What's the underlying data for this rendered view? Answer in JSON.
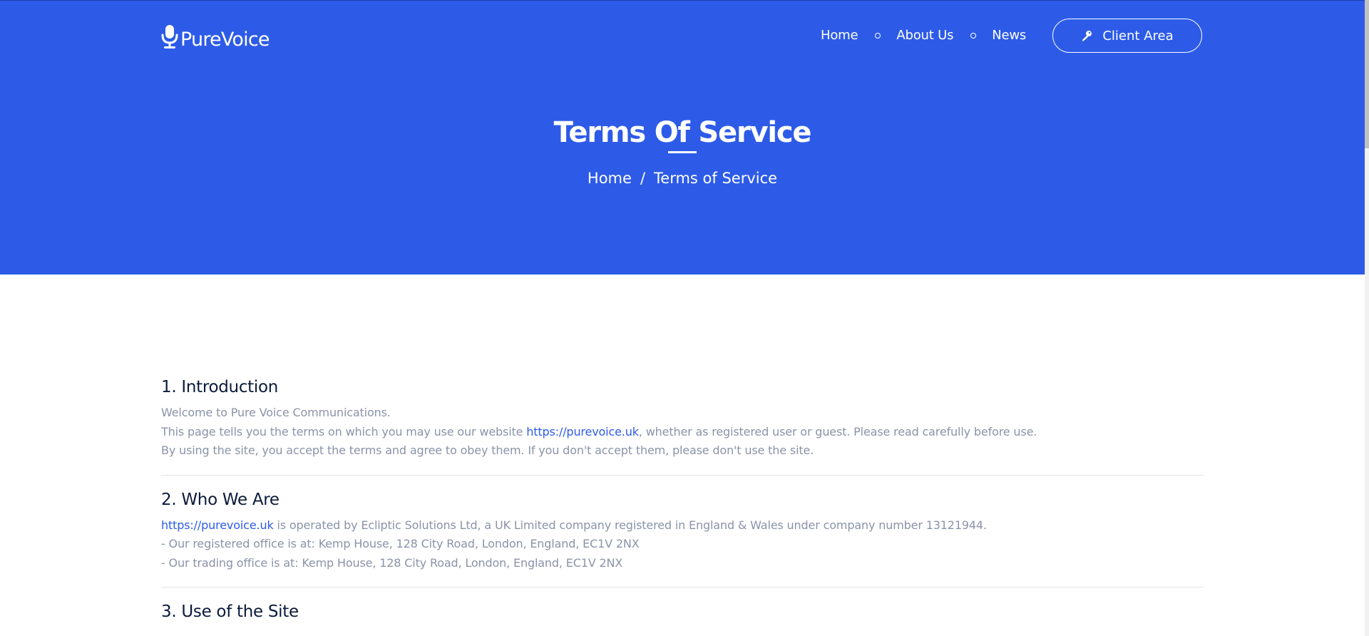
{
  "brand": {
    "name": "PureVoice",
    "logo_icon": "microphone-icon"
  },
  "nav": {
    "items": [
      {
        "label": "Home"
      },
      {
        "label": "About Us"
      },
      {
        "label": "News"
      }
    ],
    "client_area": {
      "label": "Client Area",
      "icon": "key-icon"
    }
  },
  "hero": {
    "title": "Terms Of Service",
    "breadcrumb": {
      "home": "Home",
      "separator": "/",
      "current": "Terms of Service"
    }
  },
  "colors": {
    "brand_blue": "#2d5be8",
    "heading": "#0b1a3a",
    "body_text": "#8a93a8",
    "link": "#2d5be8"
  },
  "sections": [
    {
      "heading": "1. Introduction",
      "lines": [
        {
          "text": "Welcome to Pure Voice Communications."
        },
        {
          "before": "This page tells you the terms on which you may use our website ",
          "link": "https://purevoice.uk",
          "after": ", whether as registered user or guest. Please read carefully before use."
        },
        {
          "text": "By using the site, you accept the terms and agree to obey them. If you don't accept them, please don't use the site."
        }
      ]
    },
    {
      "heading": "2. Who We Are",
      "lines": [
        {
          "link": "https://purevoice.uk",
          "after": " is operated by Ecliptic Solutions Ltd, a UK Limited company registered in England & Wales under company number 13121944."
        },
        {
          "text": "- Our registered office is at: Kemp House, 128 City Road, London, England, EC1V 2NX"
        },
        {
          "text": "- Our trading office is at: Kemp House, 128 City Road, London, England, EC1V 2NX"
        }
      ]
    },
    {
      "heading": "3. Use of the Site"
    }
  ]
}
